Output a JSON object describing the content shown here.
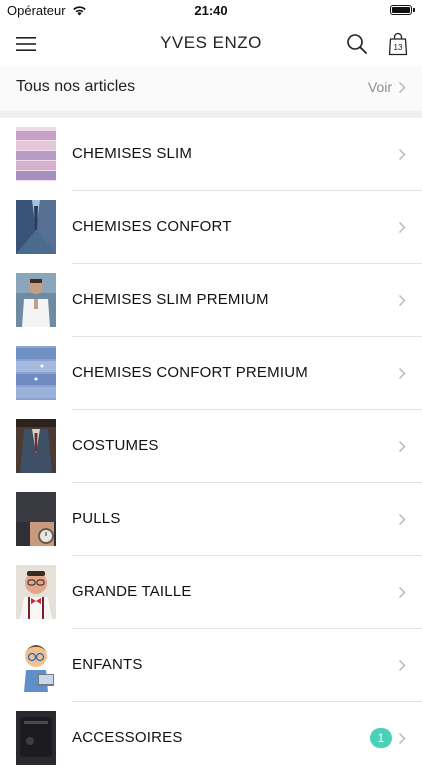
{
  "status_bar": {
    "carrier": "Opérateur",
    "time": "21:40"
  },
  "nav": {
    "title": "YVES ENZO",
    "bag_count": "13"
  },
  "all_articles": {
    "label": "Tous nos articles",
    "see_label": "Voir"
  },
  "categories": [
    {
      "label": "CHEMISES SLIM",
      "thumb": "pink-shirts"
    },
    {
      "label": "CHEMISES CONFORT",
      "thumb": "blue-suit"
    },
    {
      "label": "CHEMISES SLIM PREMIUM",
      "thumb": "man-white-shirt"
    },
    {
      "label": "CHEMISES CONFORT PREMIUM",
      "thumb": "blue-folded-shirts"
    },
    {
      "label": "COSTUMES",
      "thumb": "suit-jacket"
    },
    {
      "label": "PULLS",
      "thumb": "sweater-watch"
    },
    {
      "label": "GRANDE TAILLE",
      "thumb": "man-bowtie"
    },
    {
      "label": "ENFANTS",
      "thumb": "child-cartoon"
    },
    {
      "label": "ACCESSOIRES",
      "thumb": "dark-accessories",
      "badge": "1"
    }
  ],
  "colors": {
    "badge": "#49d2b8",
    "chevron": "#b8b8bd",
    "band": "#efefef"
  }
}
